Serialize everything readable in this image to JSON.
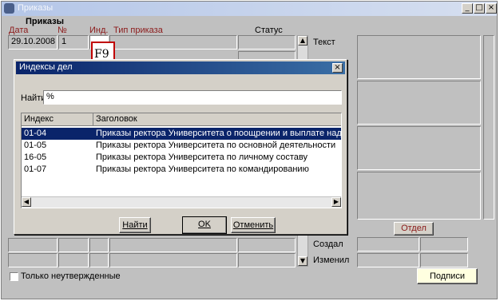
{
  "window": {
    "title": "Приказы",
    "controls": {
      "minimize": "_",
      "maximize": "□",
      "close": "×"
    }
  },
  "form": {
    "section_title": "Приказы",
    "columns": {
      "date": "Дата",
      "number": "№",
      "index": "Инд.",
      "type": "Тип приказа",
      "status": "Статус"
    },
    "first_row": {
      "date": "29.10.2008",
      "number": "1",
      "index": "",
      "type": "",
      "status": ""
    },
    "right_labels": {
      "text": "Текст",
      "created": "Создал",
      "changed": "Изменил"
    },
    "department_label": "Отдел",
    "only_unapproved_label": "Только неутвержденные",
    "signatures_button": "Подписи",
    "hotkey_callout": "F9"
  },
  "dialog": {
    "title": "Индексы дел",
    "close_glyph": "×",
    "find_label": "Найти",
    "find_value": "%",
    "grid_headers": {
      "index": "Индекс",
      "title": "Заголовок"
    },
    "rows": [
      {
        "index": "01-04",
        "title": "Приказы ректора Университета о поощрении и выплате надбавок"
      },
      {
        "index": "01-05",
        "title": "Приказы ректора Университета по основной деятельности"
      },
      {
        "index": "16-05",
        "title": "Приказы ректора Университета по личному составу"
      },
      {
        "index": "01-07",
        "title": "Приказы ректора Университета по командированию"
      }
    ],
    "selected_row": 0,
    "buttons": {
      "find": "Найти",
      "ok": "OK",
      "cancel": "Отменить"
    }
  },
  "colors": {
    "selection": "#0a246a",
    "label_red": "#8b1a1a",
    "signatures_button_bg": "#ffffe0"
  }
}
